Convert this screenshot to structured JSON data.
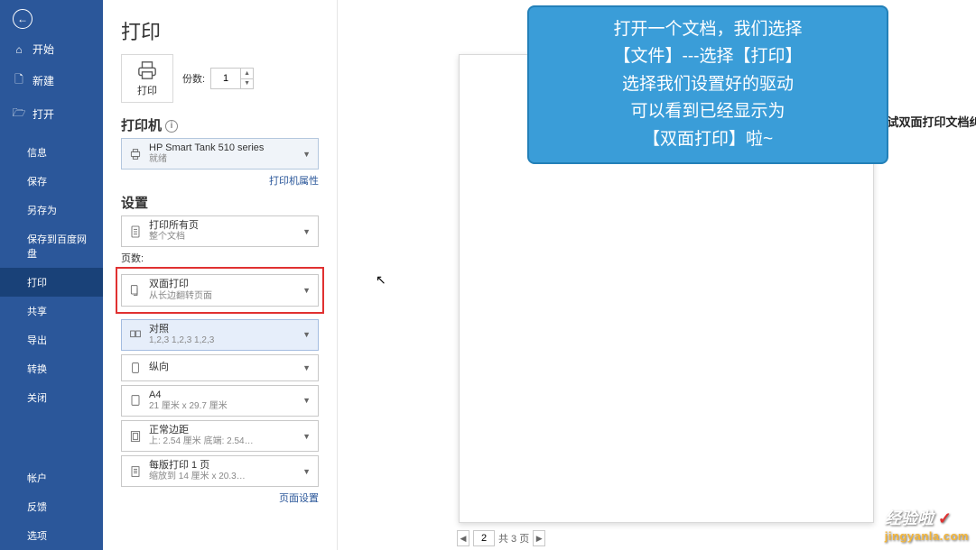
{
  "sidebar": {
    "home": "开始",
    "new": "新建",
    "open": "打开",
    "info": "信息",
    "save": "保存",
    "saveas": "另存为",
    "savetodisk": "保存到百度网盘",
    "print": "打印",
    "share": "共享",
    "export": "导出",
    "transform": "转换",
    "close": "关闭",
    "account": "帐户",
    "feedback": "反馈",
    "options": "选项"
  },
  "print": {
    "title": "打印",
    "print_btn": "打印",
    "copies_label": "份数:",
    "copies_value": "1",
    "printer_section": "打印机",
    "printer_name": "HP Smart Tank 510 series",
    "printer_status": "就绪",
    "printer_props": "打印机属性",
    "settings_section": "设置",
    "print_all_l1": "打印所有页",
    "print_all_l2": "整个文档",
    "pages_label": "页数:",
    "duplex_l1": "双面打印",
    "duplex_l2": "从长边翻转页面",
    "collate_title": "对照",
    "collate_l2": "1,2,3   1,2,3   1,2,3",
    "orient_l1": "纵向",
    "paper_l1": "A4",
    "paper_l2": "21 厘米 x 29.7 厘米",
    "margins_l1": "正常边距",
    "margins_l2": "上: 2.54 厘米 底端: 2.54…",
    "sheets_l1": "每版打印 1 页",
    "sheets_l2": "缩放到 14 厘米 x 20.3…",
    "page_setup": "页面设置"
  },
  "callout": {
    "line1": "打开一个文档，我们选择",
    "line2": "【文件】---选择【打印】",
    "line3": "选择我们设置好的驱动",
    "line4": "可以看到已经显示为",
    "line5": "【双面打印】啦~"
  },
  "preview": {
    "doc_text": "测试双面打印文档纠",
    "current_page": "2",
    "total_label": "共 3 页"
  },
  "watermark": {
    "brand": "经验啦",
    "url": "jingyanla.com"
  }
}
